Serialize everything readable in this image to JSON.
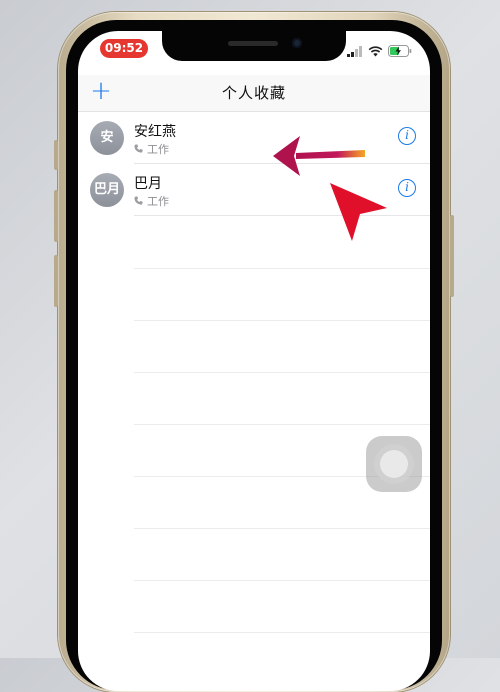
{
  "status_bar": {
    "time": "09:52",
    "icons": [
      "cellular-signal-icon",
      "wifi-icon",
      "battery-charging-icon"
    ]
  },
  "nav": {
    "add_icon": "+",
    "title": "个人收藏"
  },
  "favorites": [
    {
      "avatar_text": "安",
      "name": "安红燕",
      "label": "工作"
    },
    {
      "avatar_text": "巴月",
      "name": "巴月",
      "label": "工作"
    }
  ],
  "info_icon": "i",
  "colors": {
    "accent": "#1a7ae8",
    "time_pill": "#e5372f",
    "avatar": "#8c919a",
    "annotation_arrow_left": "#c2185b",
    "annotation_arrow_pointer": "#e0102a"
  }
}
